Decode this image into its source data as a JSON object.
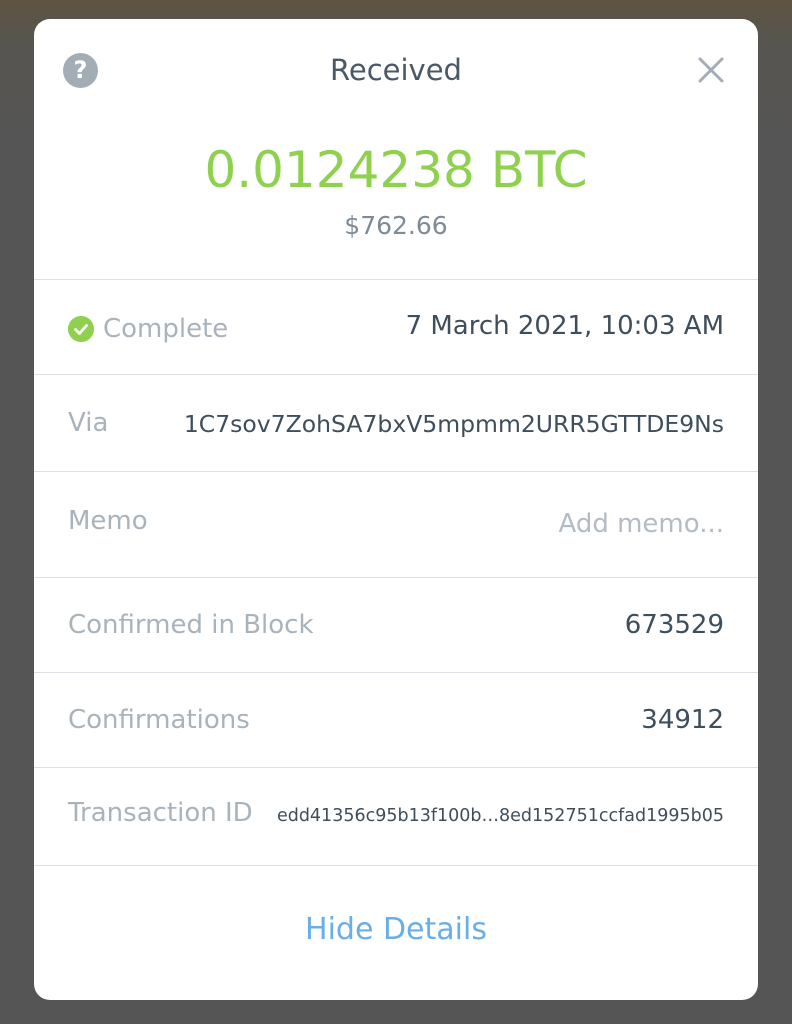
{
  "modal": {
    "title": "Received",
    "help_icon": "question-mark",
    "close_icon": "close-x",
    "amount": "0.0124238 BTC",
    "fiat_value": "$762.66"
  },
  "details": {
    "status": {
      "icon": "check-circle-icon",
      "label": "Complete",
      "datetime": "7 March 2021, 10:03 AM"
    },
    "via": {
      "label": "Via",
      "address": "1C7sov7ZohSA7bxV5mpmm2URR5GTTDE9Ns"
    },
    "memo": {
      "label": "Memo",
      "placeholder": "Add memo..."
    },
    "block": {
      "label": "Confirmed in Block",
      "value": "673529"
    },
    "confirmations": {
      "label": "Confirmations",
      "value": "34912"
    },
    "transaction_id": {
      "label": "Transaction ID",
      "value": "edd41356c95b13f100b…8ed152751ccfad1995b05"
    }
  },
  "footer": {
    "hide_details_label": "Hide Details"
  },
  "colors": {
    "amount_green": "#8fd14f",
    "link_blue": "#6aaee8",
    "label_gray": "#a9b3bc",
    "value_dark": "#3f4e5b",
    "overlay": "#555555"
  }
}
